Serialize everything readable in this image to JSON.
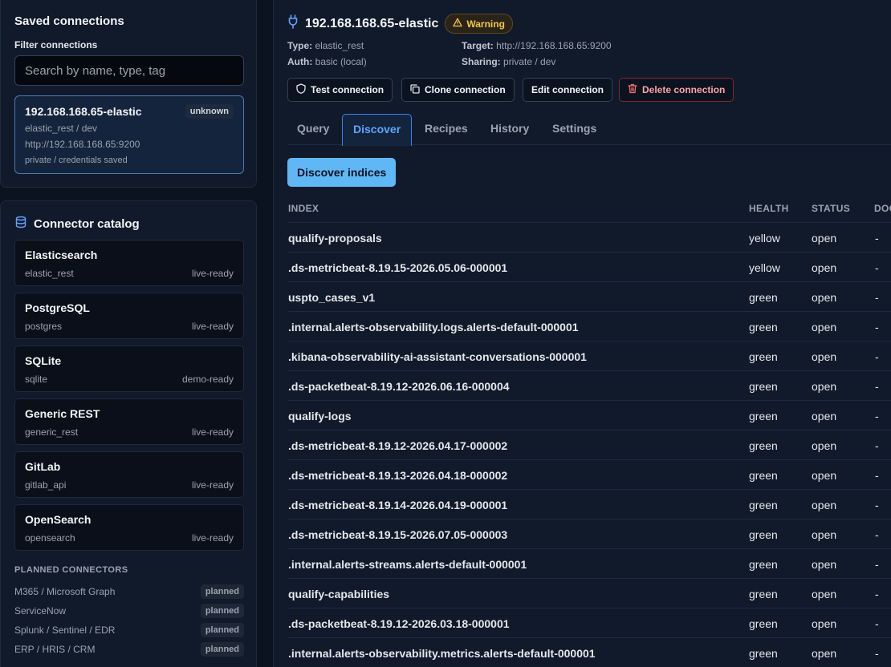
{
  "saved": {
    "title": "Saved connections",
    "filter_label": "Filter connections",
    "search_placeholder": "Search by name, type, tag",
    "connection": {
      "name": "192.168.168.65-elastic",
      "badge": "unknown",
      "type_env": "elastic_rest / dev",
      "url": "http://192.168.168.65:9200",
      "access": "private / credentials saved"
    }
  },
  "catalog": {
    "title": "Connector catalog",
    "icon": "database-icon",
    "items": [
      {
        "name": "Elasticsearch",
        "type": "elastic_rest",
        "status": "live-ready"
      },
      {
        "name": "PostgreSQL",
        "type": "postgres",
        "status": "live-ready"
      },
      {
        "name": "SQLite",
        "type": "sqlite",
        "status": "demo-ready"
      },
      {
        "name": "Generic REST",
        "type": "generic_rest",
        "status": "live-ready"
      },
      {
        "name": "GitLab",
        "type": "gitlab_api",
        "status": "live-ready"
      },
      {
        "name": "OpenSearch",
        "type": "opensearch",
        "status": "live-ready"
      }
    ],
    "planned_header": "PLANNED CONNECTORS",
    "planned": [
      {
        "name": "M365 / Microsoft Graph",
        "badge": "planned"
      },
      {
        "name": "ServiceNow",
        "badge": "planned"
      },
      {
        "name": "Splunk / Sentinel / EDR",
        "badge": "planned"
      },
      {
        "name": "ERP / HRIS / CRM",
        "badge": "planned"
      }
    ]
  },
  "main": {
    "title": "192.168.168.65-elastic",
    "warning": "Warning",
    "meta": {
      "type_label": "Type:",
      "type_value": "elastic_rest",
      "auth_label": "Auth:",
      "auth_value": "basic (local)",
      "target_label": "Target:",
      "target_value": "http://192.168.168.65:9200",
      "sharing_label": "Sharing:",
      "sharing_value": "private / dev"
    },
    "buttons": {
      "test": "Test connection",
      "clone": "Clone connection",
      "edit": "Edit connection",
      "delete": "Delete connection"
    },
    "tabs": [
      "Query",
      "Discover",
      "Recipes",
      "History",
      "Settings"
    ],
    "active_tab": "Discover",
    "discover_button": "Discover indices",
    "table": {
      "headers": [
        "INDEX",
        "HEALTH",
        "STATUS",
        "DOC"
      ],
      "rows": [
        {
          "index": "qualify-proposals",
          "health": "yellow",
          "status": "open",
          "docs": "-"
        },
        {
          "index": ".ds-metricbeat-8.19.15-2026.05.06-000001",
          "health": "yellow",
          "status": "open",
          "docs": "-"
        },
        {
          "index": "uspto_cases_v1",
          "health": "green",
          "status": "open",
          "docs": "-"
        },
        {
          "index": ".internal.alerts-observability.logs.alerts-default-000001",
          "health": "green",
          "status": "open",
          "docs": "-"
        },
        {
          "index": ".kibana-observability-ai-assistant-conversations-000001",
          "health": "green",
          "status": "open",
          "docs": "-"
        },
        {
          "index": ".ds-packetbeat-8.19.12-2026.06.16-000004",
          "health": "green",
          "status": "open",
          "docs": "-"
        },
        {
          "index": "qualify-logs",
          "health": "green",
          "status": "open",
          "docs": "-"
        },
        {
          "index": ".ds-metricbeat-8.19.12-2026.04.17-000002",
          "health": "green",
          "status": "open",
          "docs": "-"
        },
        {
          "index": ".ds-metricbeat-8.19.13-2026.04.18-000002",
          "health": "green",
          "status": "open",
          "docs": "-"
        },
        {
          "index": ".ds-metricbeat-8.19.14-2026.04.19-000001",
          "health": "green",
          "status": "open",
          "docs": "-"
        },
        {
          "index": ".ds-metricbeat-8.19.15-2026.07.05-000003",
          "health": "green",
          "status": "open",
          "docs": "-"
        },
        {
          "index": ".internal.alerts-streams.alerts-default-000001",
          "health": "green",
          "status": "open",
          "docs": "-"
        },
        {
          "index": "qualify-capabilities",
          "health": "green",
          "status": "open",
          "docs": "-"
        },
        {
          "index": ".ds-packetbeat-8.19.12-2026.03.18-000001",
          "health": "green",
          "status": "open",
          "docs": "-"
        },
        {
          "index": ".internal.alerts-observability.metrics.alerts-default-000001",
          "health": "green",
          "status": "open",
          "docs": "-"
        }
      ]
    }
  }
}
